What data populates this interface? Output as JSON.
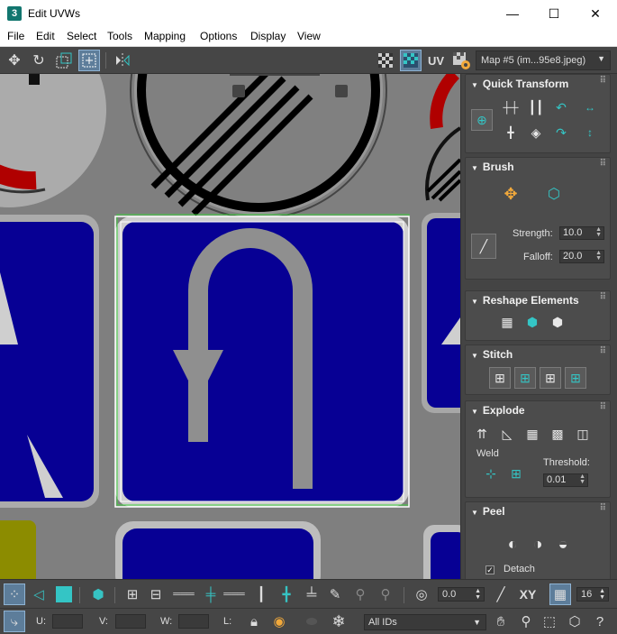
{
  "window": {
    "app_icon": "3",
    "title": "Edit UVWs",
    "minimize": "—",
    "maximize": "☐",
    "close": "✕"
  },
  "menu": [
    "File",
    "Edit",
    "Select",
    "Tools",
    "Mapping",
    "Options",
    "Display",
    "View"
  ],
  "toolbar": {
    "uv_label": "UV",
    "map_select": "Map #5 (im...95e8.jpeg)"
  },
  "panel": {
    "quick_transform": {
      "title": "Quick Transform"
    },
    "brush": {
      "title": "Brush",
      "strength_label": "Strength:",
      "strength_value": "10.0",
      "falloff_label": "Falloff:",
      "falloff_value": "20.0"
    },
    "reshape": {
      "title": "Reshape Elements"
    },
    "stitch": {
      "title": "Stitch"
    },
    "explode": {
      "title": "Explode",
      "weld_label": "Weld",
      "threshold_label": "Threshold:",
      "threshold_value": "0.01"
    },
    "peel": {
      "title": "Peel",
      "detach_label": "Detach",
      "detach_checked": true
    }
  },
  "bottom": {
    "angle_value": "0.0",
    "xy_label": "XY",
    "grid_value": "16",
    "u_label": "U:",
    "v_label": "V:",
    "w_label": "W:",
    "l_label": "L:",
    "ids_select": "All IDs"
  },
  "colors": {
    "accent_teal": "#34c5c5",
    "sign_blue": "#070094",
    "sign_border_red": "#b00000",
    "selection_green": "#3cd23c"
  },
  "icons": {
    "move": "move-icon",
    "rotate": "rotate-icon",
    "scale": "scale-icon",
    "freeform": "freeform-icon",
    "mirror": "mirror-icon"
  }
}
